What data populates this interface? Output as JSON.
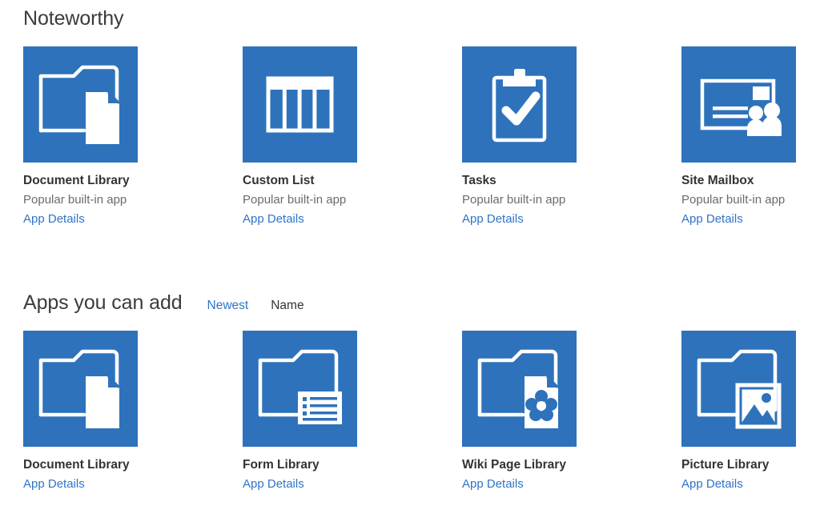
{
  "theme": {
    "tile_blue": "#2e72bb",
    "link_blue": "#2e74c8",
    "title_gray": "#333333",
    "subtitle_gray": "#6b6b6b",
    "heading_gray": "#3b3b3b",
    "background": "#ffffff"
  },
  "noteworthy": {
    "heading": "Noteworthy",
    "apps": [
      {
        "name": "Document Library",
        "subtitle": "Popular built-in app",
        "details_label": "App Details",
        "icon": "folder-document-icon"
      },
      {
        "name": "Custom List",
        "subtitle": "Popular built-in app",
        "details_label": "App Details",
        "icon": "table-columns-icon"
      },
      {
        "name": "Tasks",
        "subtitle": "Popular built-in app",
        "details_label": "App Details",
        "icon": "clipboard-check-icon"
      },
      {
        "name": "Site Mailbox",
        "subtitle": "Popular built-in app",
        "details_label": "App Details",
        "icon": "mailbox-people-icon"
      }
    ]
  },
  "addable": {
    "heading": "Apps you can add",
    "sort": {
      "newest_label": "Newest",
      "name_label": "Name",
      "active": "Newest"
    },
    "apps": [
      {
        "name": "Document Library",
        "details_label": "App Details",
        "icon": "folder-document-icon"
      },
      {
        "name": "Form Library",
        "details_label": "App Details",
        "icon": "folder-form-icon"
      },
      {
        "name": "Wiki Page Library",
        "details_label": "App Details",
        "icon": "folder-wiki-icon"
      },
      {
        "name": "Picture Library",
        "details_label": "App Details",
        "icon": "folder-picture-icon"
      }
    ]
  }
}
